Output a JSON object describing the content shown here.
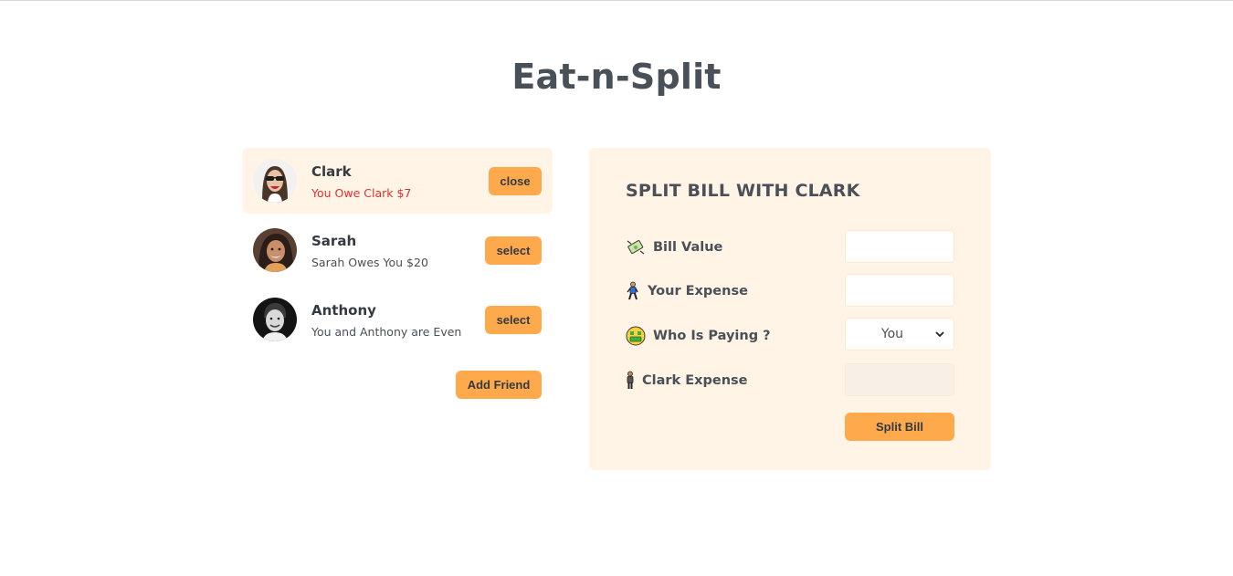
{
  "page": {
    "title": "Eat-n-Split"
  },
  "friends": [
    {
      "name": "Clark",
      "status": "You Owe Clark $7",
      "status_color": "#e03131",
      "button": "close",
      "selected": true
    },
    {
      "name": "Sarah",
      "status": "Sarah Owes You $20",
      "status_color": "#495057",
      "button": "select",
      "selected": false
    },
    {
      "name": "Anthony",
      "status": "You and Anthony are Even",
      "status_color": "#495057",
      "button": "select",
      "selected": false
    }
  ],
  "add_friend_label": "Add Friend",
  "split_form": {
    "title": "SPLIT BILL WITH CLARK",
    "bill_value": {
      "label": "Bill Value",
      "icon": "money-with-wings-icon",
      "value": ""
    },
    "your_expense": {
      "label": "Your Expense",
      "icon": "person-walking-icon",
      "value": ""
    },
    "who_is_paying": {
      "label": "Who Is Paying ?",
      "icon": "money-mouth-face-icon",
      "selected": "You"
    },
    "friend_expense": {
      "label": "Clark Expense",
      "icon": "person-standing-icon",
      "value": ""
    },
    "submit_label": "Split Bill"
  },
  "colors": {
    "accent": "#ffa94d",
    "panel_background": "#fff4e6",
    "text": "#495057",
    "owe_red": "#e03131"
  }
}
